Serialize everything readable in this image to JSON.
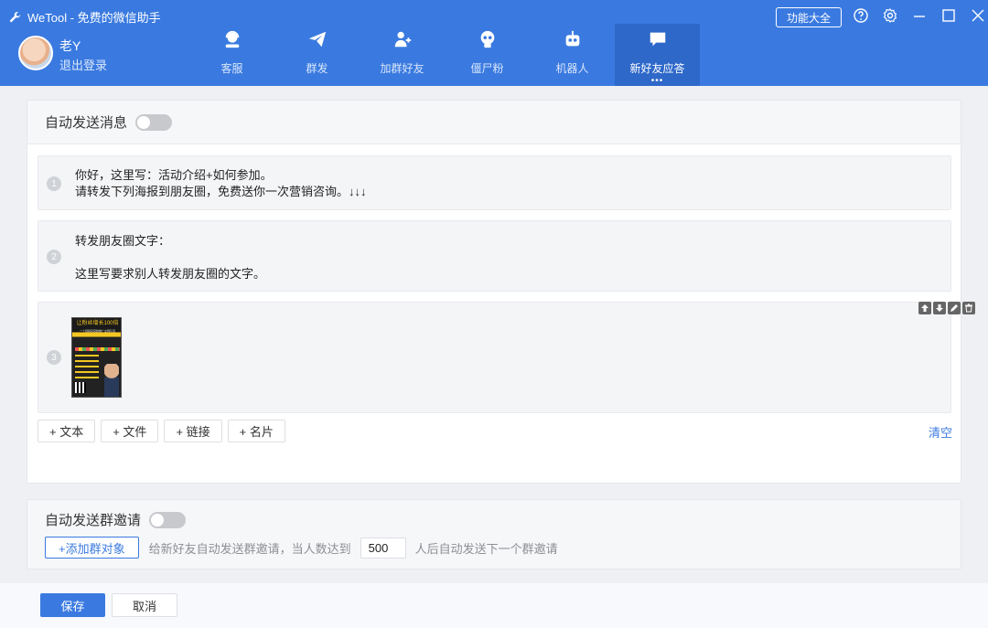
{
  "app": {
    "title": "WeTool - 免费的微信助手"
  },
  "user": {
    "name": "老Y",
    "logout": "退出登录"
  },
  "nav": [
    {
      "label": "客服",
      "icon": "customer-service-icon"
    },
    {
      "label": "群发",
      "icon": "paper-plane-icon"
    },
    {
      "label": "加群好友",
      "icon": "add-friend-icon"
    },
    {
      "label": "僵尸粉",
      "icon": "zombie-icon"
    },
    {
      "label": "机器人",
      "icon": "robot-icon"
    },
    {
      "label": "新好友应答",
      "icon": "chat-icon",
      "active": true
    }
  ],
  "nav_more": "•••",
  "header": {
    "func_button": "功能大全"
  },
  "auto_send": {
    "title": "自动发送消息",
    "messages": [
      {
        "num": "1",
        "lines": [
          "你好，这里写：活动介绍+如何参加。",
          "请转发下列海报到朋友圈，免费送你一次营销咨询。↓↓↓"
        ]
      },
      {
        "num": "2",
        "lines": [
          "转发朋友圈文字：",
          "",
          "这里写要求别人转发朋友圈的文字。"
        ]
      },
      {
        "num": "3",
        "type": "image",
        "poster_title": "让粉丝增长100倍",
        "poster_sub": "一个视频就突破推广全网引流"
      }
    ],
    "add_buttons": [
      "+ 文本",
      "+ 文件",
      "+ 链接",
      "+ 名片"
    ],
    "clear": "清空"
  },
  "group_invite": {
    "title": "自动发送群邀请",
    "add_button": "+添加群对象",
    "hint_before": "给新好友自动发送群邀请，当人数达到",
    "count": "500",
    "hint_after": "人后自动发送下一个群邀请"
  },
  "footer": {
    "save": "保存",
    "cancel": "取消"
  },
  "colors": {
    "accent": "#3a7ae0",
    "header_active": "#2e68c9"
  }
}
